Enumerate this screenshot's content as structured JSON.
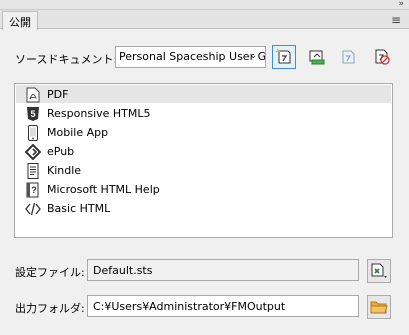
{
  "panel": {
    "tab_label": "公開",
    "collapse_glyph": "»",
    "menu_glyph": "≡"
  },
  "source": {
    "label": "ソースドキュメント:",
    "selected": "Personal Spaceship User G"
  },
  "toolbar": {
    "buttons": [
      {
        "name": "new-target-button",
        "icon": "new-target-icon"
      },
      {
        "name": "edit-target-button",
        "icon": "edit-target-icon"
      },
      {
        "name": "copy-target-button",
        "icon": "copy-target-icon"
      },
      {
        "name": "remove-target-button",
        "icon": "remove-target-icon"
      }
    ]
  },
  "targets": {
    "selected_index": 0,
    "items": [
      {
        "label": "PDF",
        "icon": "pdf-icon"
      },
      {
        "label": "Responsive HTML5",
        "icon": "html5-icon"
      },
      {
        "label": "Mobile App",
        "icon": "mobile-icon"
      },
      {
        "label": "ePub",
        "icon": "epub-icon"
      },
      {
        "label": "Kindle",
        "icon": "kindle-icon"
      },
      {
        "label": "Microsoft HTML Help",
        "icon": "help-icon"
      },
      {
        "label": "Basic HTML",
        "icon": "code-icon"
      }
    ]
  },
  "settings": {
    "label": "設定ファイル:",
    "value": "Default.sts"
  },
  "output": {
    "label": "出力フォルダ:",
    "value": "C:¥Users¥Administrator¥FMOutput"
  },
  "colors": {
    "accent": "#3c8ce7",
    "folder": "#e8a93a"
  }
}
